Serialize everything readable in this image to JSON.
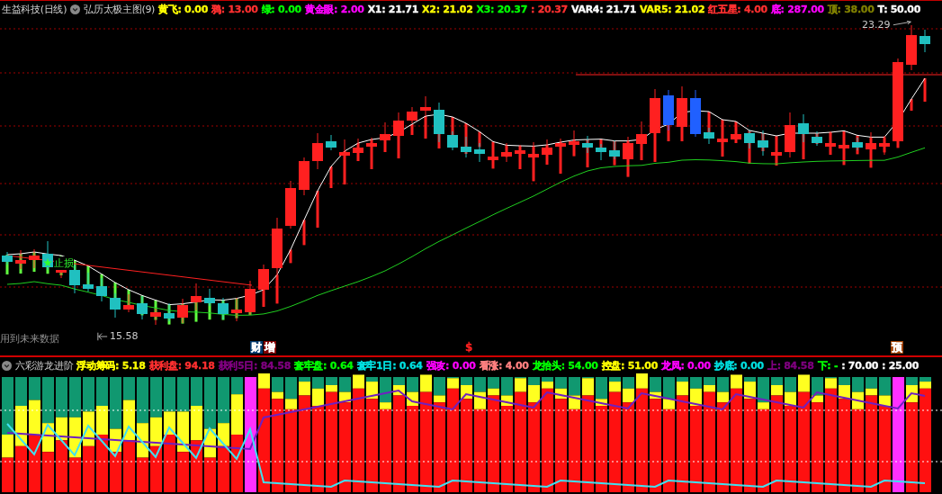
{
  "main_panel": {
    "stock_title": "生益科技(日线)",
    "indicator_name": "弘历太极主图(9)",
    "readouts": [
      {
        "text": "黄飞: 0.00",
        "color": "#ffff00"
      },
      {
        "text": "鸦: 13.00",
        "color": "#ff3030"
      },
      {
        "text": "绿: 0.00",
        "color": "#00ff00"
      },
      {
        "text": "黄金眼: 2.00",
        "color": "#ff00ff"
      },
      {
        "text": "X1: 21.71",
        "color": "#ffffff"
      },
      {
        "text": "X2: 21.02",
        "color": "#ffff00"
      },
      {
        "text": "X3: 20.37",
        "color": "#00ff00"
      },
      {
        "text": ": 20.37",
        "color": "#ff3030"
      },
      {
        "text": "VAR4: 21.71",
        "color": "#ffffff"
      },
      {
        "text": "VAR5: 21.02",
        "color": "#ffff00"
      },
      {
        "text": "红五星: 4.00",
        "color": "#ff3030"
      },
      {
        "text": "底: 287.00",
        "color": "#ff00ff"
      },
      {
        "text": "顶: 38.00",
        "color": "#808000"
      },
      {
        "text": "T: 50.00",
        "color": "#ffffff"
      }
    ],
    "high_marker": "23.29",
    "low_marker": "15.58",
    "stop_loss_label": "止损",
    "future_data_note": "用到未来数据",
    "event_marks": [
      {
        "text": "财",
        "kind": "badge",
        "color": "#003a6e"
      },
      {
        "text": "增",
        "kind": "badge",
        "color": "#800000"
      },
      {
        "text": "$",
        "kind": "symbol",
        "color": "#ff2020"
      },
      {
        "text": "预",
        "kind": "badge",
        "color": "#a04000"
      }
    ]
  },
  "sub_panel": {
    "indicator_name": "六彩游龙进阶",
    "readouts": [
      {
        "text": "浮动筹码: 5.18",
        "color": "#ffff00"
      },
      {
        "text": "获利盘: 94.18",
        "color": "#ff3030"
      },
      {
        "text": "获利5日: 84.58",
        "color": "#800080"
      },
      {
        "text": "套牢盘: 0.64",
        "color": "#00ff00"
      },
      {
        "text": "套牢1日: 0.64",
        "color": "#00e0e0"
      },
      {
        "text": "强攻: 0.00",
        "color": "#ff00ff"
      },
      {
        "text": "看涨: 4.00",
        "color": "#ff8080"
      },
      {
        "text": "龙抬头: 54.00",
        "color": "#00ff00"
      },
      {
        "text": "控盘: 51.00",
        "color": "#ffff00"
      },
      {
        "text": "龙凤: 0.00",
        "color": "#ff00ff"
      },
      {
        "text": "抄底: 0.00",
        "color": "#00e0e0"
      },
      {
        "text": "上: 84.58",
        "color": "#800080"
      },
      {
        "text": "下: -",
        "color": "#00ff00"
      },
      {
        "text": ": 70.00",
        "color": "#ffffff"
      },
      {
        "text": ": 25.00",
        "color": "#ffffff"
      }
    ]
  }
}
